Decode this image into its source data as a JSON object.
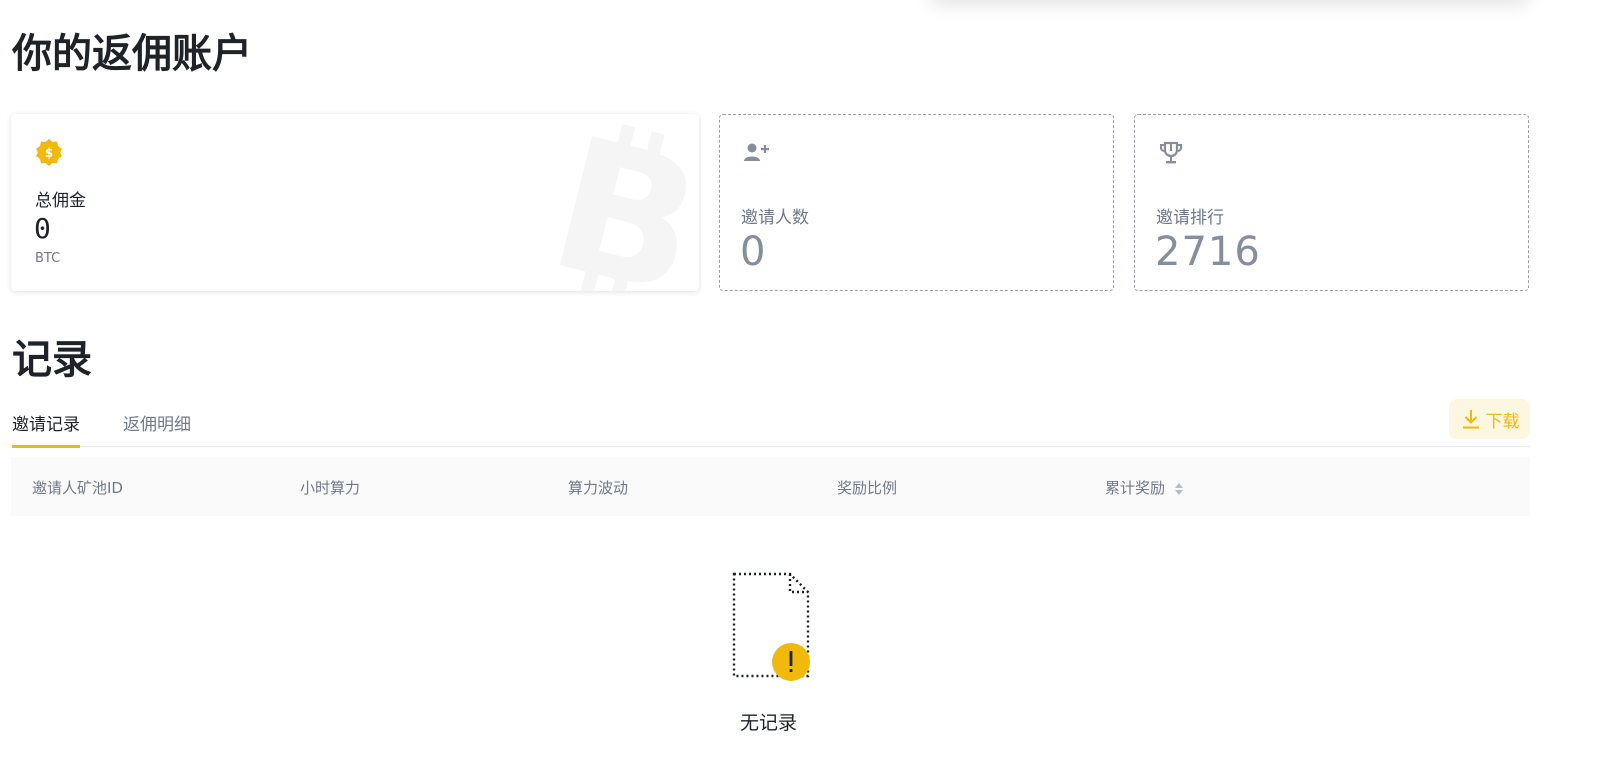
{
  "page": {
    "title": "你的返佣账户"
  },
  "cards": {
    "total": {
      "label": "总佣金",
      "value": "0",
      "unit": "BTC"
    },
    "invite": {
      "label": "邀请人数",
      "value": "0"
    },
    "rank": {
      "label": "邀请排行",
      "value": "2716"
    }
  },
  "records": {
    "title": "记录",
    "tabs": [
      {
        "label": "邀请记录",
        "active": true
      },
      {
        "label": "返佣明细",
        "active": false
      }
    ],
    "download_label": "下载",
    "columns": [
      "邀请人矿池ID",
      "小时算力",
      "算力波动",
      "奖励比例",
      "累计奖励"
    ],
    "empty_text": "无记录"
  },
  "colors": {
    "accent": "#f0b90b",
    "text_primary": "#1e2329",
    "text_secondary": "#707a8a"
  },
  "icons": {
    "total": "coin-badge-icon",
    "invite": "add-user-icon",
    "rank": "trophy-icon",
    "download": "download-icon",
    "sort": "sort-icon",
    "empty": "empty-document-icon"
  }
}
